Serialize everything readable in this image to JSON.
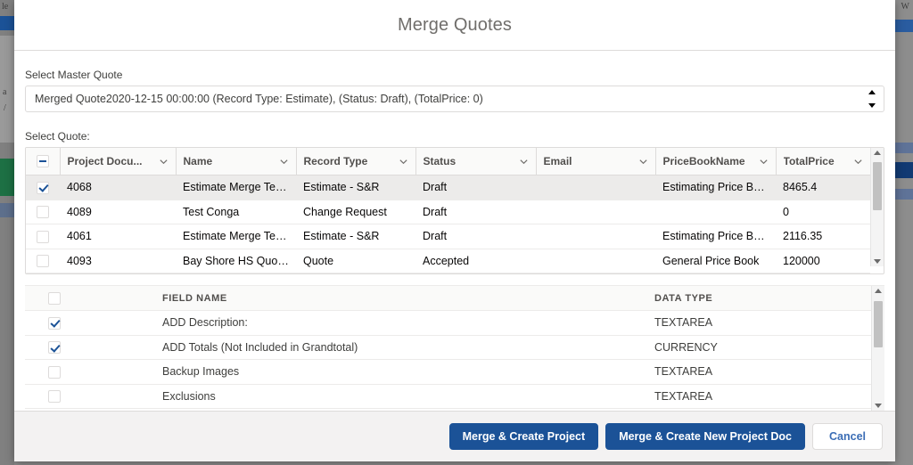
{
  "modal": {
    "title": "Merge Quotes"
  },
  "master_quote": {
    "label": "Select Master Quote",
    "value": "Merged Quote2020-12-15 00:00:00 (Record Type: Estimate), (Status: Draft), (TotalPrice: 0)",
    "options": [
      "Merged Quote2020-12-15 00:00:00 (Record Type: Estimate), (Status: Draft), (TotalPrice: 0)"
    ]
  },
  "quote_section": {
    "label": "Select Quote:",
    "header_checkbox_state": "indeterminate",
    "columns": [
      {
        "label": "Project Docu...",
        "sortable": true
      },
      {
        "label": "Name",
        "sortable": true
      },
      {
        "label": "Record Type",
        "sortable": true
      },
      {
        "label": "Status",
        "sortable": true
      },
      {
        "label": "Email",
        "sortable": true
      },
      {
        "label": "PriceBookName",
        "sortable": true
      },
      {
        "label": "TotalPrice",
        "sortable": true
      }
    ],
    "rows": [
      {
        "checked": true,
        "selected": true,
        "project_doc": "4068",
        "name": "Estimate Merge Tes...",
        "record_type": "Estimate - S&R",
        "status": "Draft",
        "email": "",
        "price_book": "Estimating Price Bo...",
        "total_price": "8465.4"
      },
      {
        "checked": false,
        "selected": false,
        "project_doc": "4089",
        "name": "Test Conga",
        "record_type": "Change Request",
        "status": "Draft",
        "email": "",
        "price_book": "",
        "total_price": "0"
      },
      {
        "checked": false,
        "selected": false,
        "project_doc": "4061",
        "name": "Estimate Merge Tes...",
        "record_type": "Estimate - S&R",
        "status": "Draft",
        "email": "",
        "price_book": "Estimating Price Bo...",
        "total_price": "2116.35"
      },
      {
        "checked": false,
        "selected": false,
        "project_doc": "4093",
        "name": "Bay Shore HS Quot...",
        "record_type": "Quote",
        "status": "Accepted",
        "email": "",
        "price_book": "General Price Book",
        "total_price": "120000"
      }
    ]
  },
  "field_section": {
    "header_checkbox_state": "unchecked",
    "columns": [
      {
        "label": "FIELD NAME"
      },
      {
        "label": "DATA TYPE"
      }
    ],
    "rows": [
      {
        "checked": true,
        "field_name": "ADD Description:",
        "data_type": "TEXTAREA"
      },
      {
        "checked": true,
        "field_name": "ADD Totals (Not Included in Grandtotal)",
        "data_type": "CURRENCY"
      },
      {
        "checked": false,
        "field_name": "Backup Images",
        "data_type": "TEXTAREA"
      },
      {
        "checked": false,
        "field_name": "Exclusions",
        "data_type": "TEXTAREA"
      }
    ]
  },
  "footer": {
    "merge_create_project_label": "Merge & Create Project",
    "merge_create_new_doc_label": "Merge & Create New Project Doc",
    "cancel_label": "Cancel"
  },
  "colors": {
    "primary": "#1b5297",
    "link": "#3b6db5",
    "border": "#dddbda",
    "header_bg": "#fafaf9",
    "footer_bg": "#f3f2f2",
    "selected_row": "#ecebea"
  },
  "background_page": {
    "fragments": [
      "le",
      "a",
      "/",
      "W"
    ]
  }
}
